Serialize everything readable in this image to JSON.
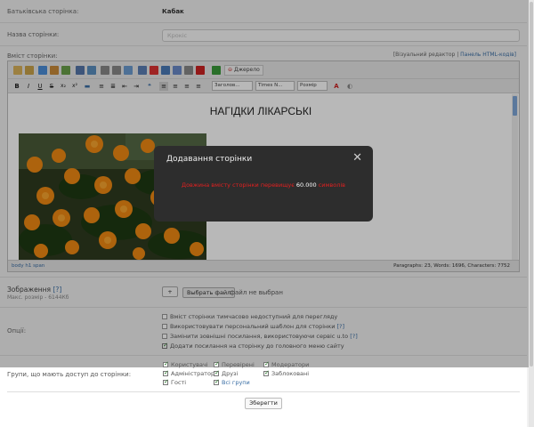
{
  "parent_page": {
    "label": "Батьківська сторінка:",
    "value": "Кабак"
  },
  "page_title": {
    "label": "Назва сторінки:",
    "placeholder": "Крокіс"
  },
  "content": {
    "label": "Вміст сторінки:",
    "visual_editor_link": "[Візуальний редактор",
    "separator": "|",
    "html_panel_link": "Панель HTML-кодів]",
    "heading": "НАГІДКИ ЛІКАРСЬКІ",
    "toolbar": {
      "source_button": "Джерело",
      "style_dropdown": "Заголов...",
      "font_dropdown": "Times N...",
      "size_dropdown": "Розмір"
    },
    "status_path": "body   h1   span",
    "status_counts": "Paragraphs: 23, Words: 1696, Characters: 7752"
  },
  "modal": {
    "title": "Додавання сторінки",
    "message_before": "Довжина вмісту сторінки перевищує",
    "limit": "60.000",
    "message_after": "символів"
  },
  "image": {
    "label": "Зображення",
    "help": "[?]",
    "max_size": "Макс. розмір - 6144Кб",
    "add_button": "+",
    "choose_button": "Выбрать файл",
    "no_file": "файл не выбран"
  },
  "options": {
    "label": "Опції:",
    "items": [
      {
        "text": "Вміст сторінки тимчасово недоступний для перегляду",
        "checked": false
      },
      {
        "text": "Використовувати персональний шаблон для сторінки",
        "help": "[?]",
        "checked": false
      },
      {
        "text": "Замінити зовнішні посилання, використовуючи сервіс u.to",
        "help": "[?]",
        "checked": false
      },
      {
        "text": "Додати посилання на сторінку до головного меню сайту",
        "checked": true
      }
    ]
  },
  "groups": {
    "label": "Групи, що мають доступ до сторінки:",
    "items": [
      {
        "text": "Користувачі",
        "checked": true
      },
      {
        "text": "Перевірені",
        "checked": true
      },
      {
        "text": "Модератори",
        "checked": true
      },
      {
        "text": "Адміністратори",
        "checked": true
      },
      {
        "text": "Друзі",
        "checked": true
      },
      {
        "text": "Заблоковані",
        "checked": true
      },
      {
        "text": "Гості",
        "checked": true
      },
      {
        "text": "Всі групи",
        "checked": true
      }
    ]
  },
  "save_button": "Зберегти",
  "colors": {
    "link": "#3a6ea5",
    "modal_bg": "#2d2d2d",
    "error": "#e02020",
    "check": "#2a7a2a"
  }
}
